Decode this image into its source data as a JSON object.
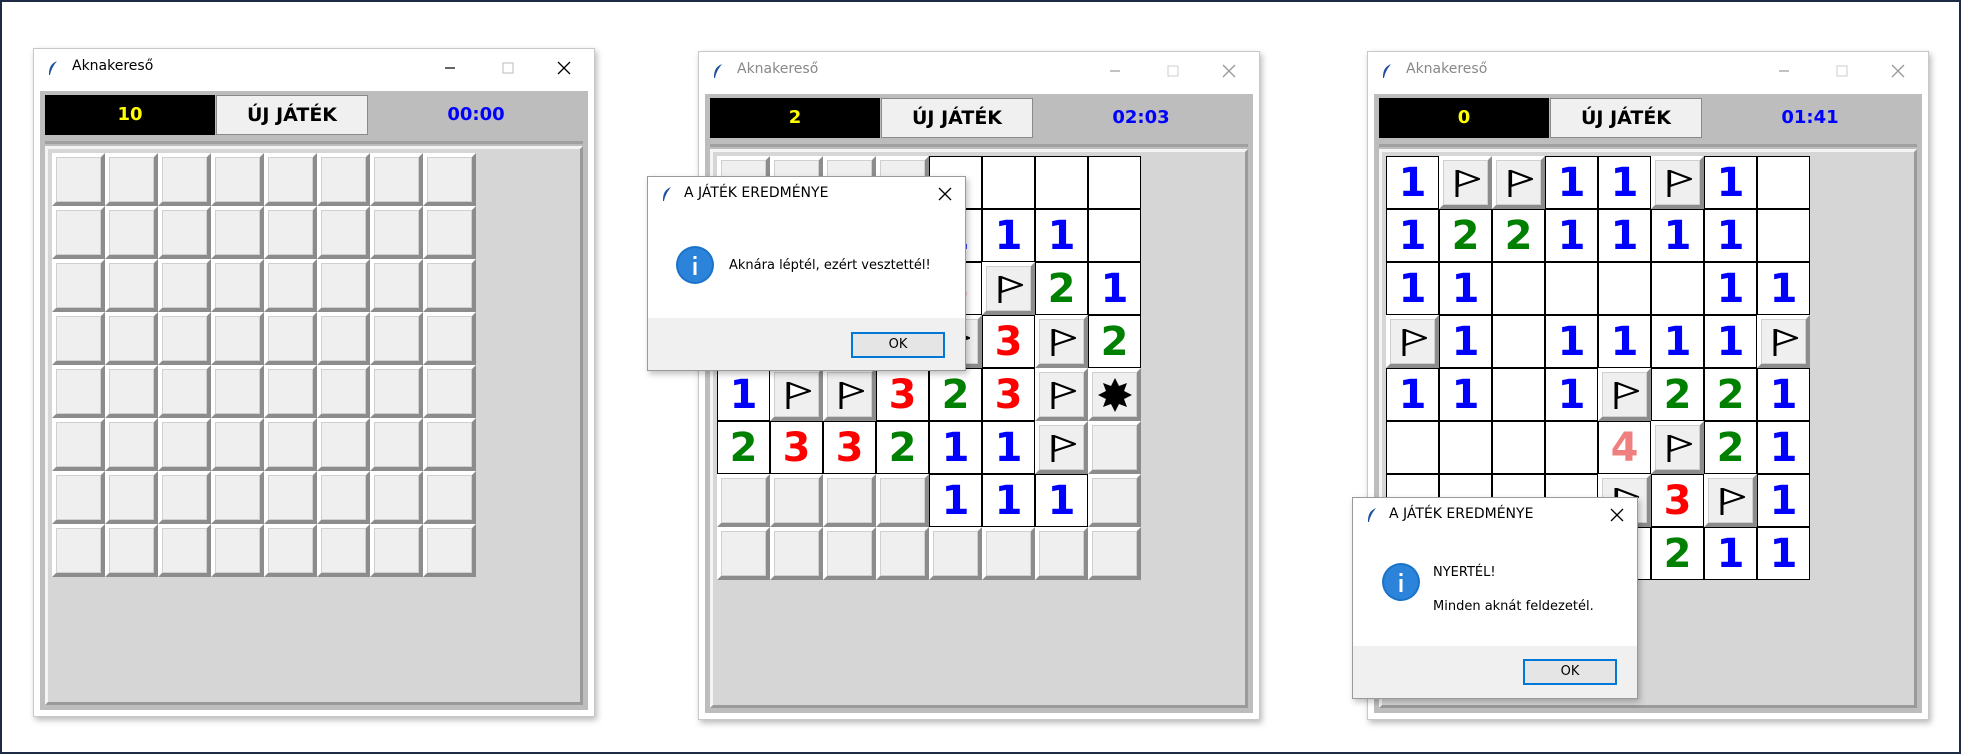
{
  "colors": {
    "n1": "#0000ff",
    "n2": "#008000",
    "n3": "#ff0000",
    "n4": "#f08080",
    "counter_bg": "#000000",
    "counter_fg": "#ffff00",
    "timer_fg": "#0000ff"
  },
  "windows": [
    {
      "title": "Aknakereső",
      "counter": "10",
      "new_game_label": "ÚJ JÁTÉK",
      "timer": "00:00",
      "board": [
        "########",
        "########",
        "########",
        "########",
        "########",
        "########",
        "########",
        "########"
      ]
    },
    {
      "title": "Aknakereső",
      "counter": "2",
      "new_game_label": "ÚJ JÁTÉK",
      "timer": "02:03",
      "board": [
        "####____",
        "####111_",
        "####3F21",
        "123FF3F2",
        "1FF323F*",
        "233211F#",
        "####111#",
        "########"
      ],
      "dialog": {
        "title": "A JÁTÉK EREDMÉNYE",
        "messages": [
          "Aknára léptél, ezért vesztettél!"
        ],
        "ok_label": "OK"
      }
    },
    {
      "title": "Aknakereső",
      "counter": "0",
      "new_game_label": "ÚJ JÁTÉK",
      "timer": "01:41",
      "board": [
        "1FF11F1_",
        "1221111_",
        "11____11",
        "F1_1111F",
        "11_1F221",
        "____4F21",
        "____F3F1",
        "____2211"
      ],
      "dialog": {
        "title": "A JÁTÉK EREDMÉNYE",
        "messages": [
          "NYERTÉL!",
          "Minden aknát feldezetél."
        ],
        "ok_label": "OK"
      }
    }
  ]
}
